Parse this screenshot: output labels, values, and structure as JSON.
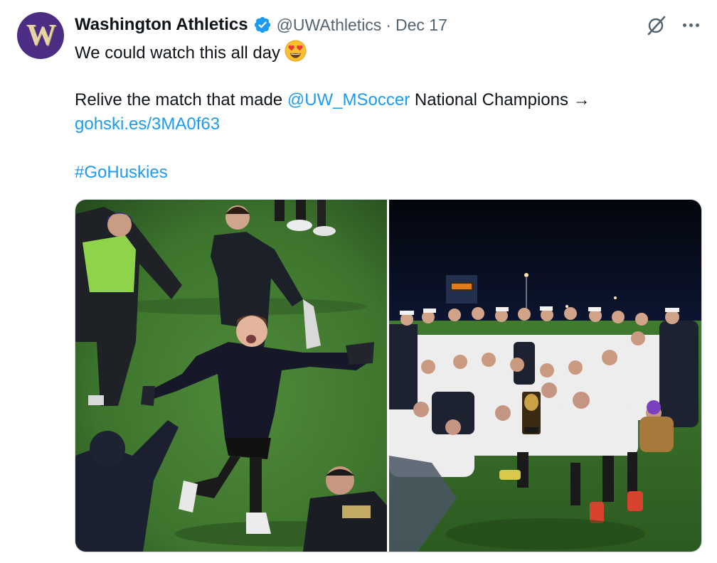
{
  "author": {
    "avatar_letter": "W",
    "display_name": "Washington Athletics",
    "handle": "@UWAthletics",
    "separator": "·",
    "date": "Dec 17"
  },
  "tweet": {
    "line1": "We could watch this all day",
    "line1_emoji": "heart-eyes-emoji",
    "line2_prefix": "Relive the match that made ",
    "line2_mention": "@UW_MSoccer",
    "line2_suffix": " National Champions →",
    "link": "gohski.es/3MA0f63",
    "hashtag": "#GoHuskies"
  },
  "media": {
    "images": [
      {
        "name": "celebrating-player-photo"
      },
      {
        "name": "team-celebration-photo"
      }
    ]
  },
  "colors": {
    "link": "#1d9bf0",
    "verified": "#1d9bf0",
    "avatar_bg": "#4b2e83",
    "text": "#0f1419",
    "secondary": "#536471"
  },
  "icons": {
    "verified": "verified-badge-icon",
    "grok": "grok-icon",
    "more": "more-options-icon"
  }
}
